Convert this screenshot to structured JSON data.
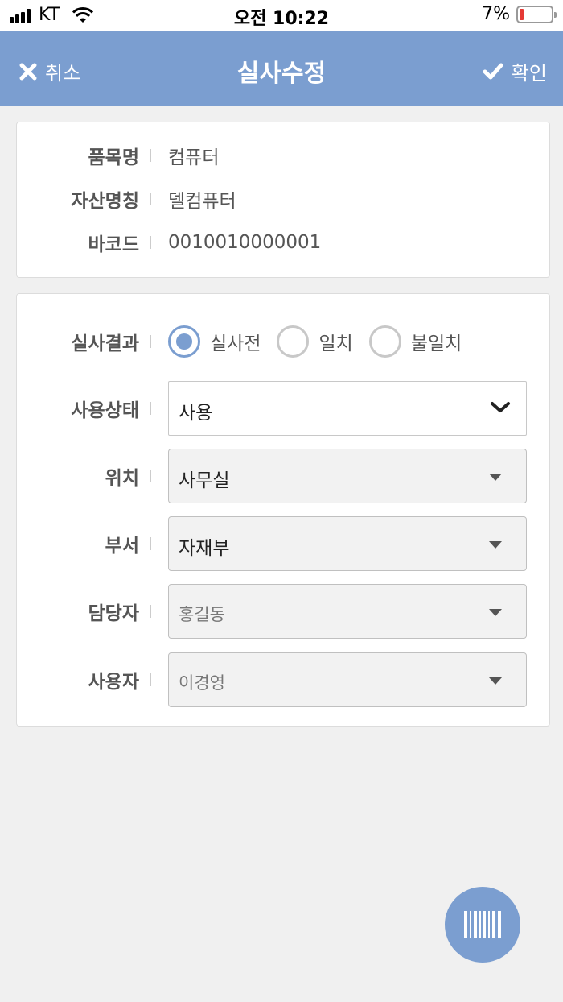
{
  "status_bar": {
    "carrier": "KT",
    "time": "오전 10:22",
    "battery_pct": "7%",
    "battery_level": 0.07,
    "battery_color": "#e53935"
  },
  "header": {
    "cancel_label": "취소",
    "title": "실사수정",
    "confirm_label": "확인",
    "background": "#7b9ed0"
  },
  "asset_info": {
    "item_name_label": "품목명",
    "item_name_value": "컴퓨터",
    "asset_name_label": "자산명칭",
    "asset_name_value": "델컴퓨터",
    "barcode_label": "바코드",
    "barcode_value": "0010010000001"
  },
  "form": {
    "audit_result_label": "실사결과",
    "audit_options": [
      {
        "label": "실사전",
        "checked": true
      },
      {
        "label": "일치",
        "checked": false
      },
      {
        "label": "불일치",
        "checked": false
      }
    ],
    "usage_status_label": "사용상태",
    "usage_status_value": "사용",
    "location_label": "위치",
    "location_value": "사무실",
    "department_label": "부서",
    "department_value": "자재부",
    "manager_label": "담당자",
    "manager_value": "홍길동",
    "user_label": "사용자",
    "user_value": "이경영"
  },
  "fab": {
    "icon": "barcode-icon"
  }
}
